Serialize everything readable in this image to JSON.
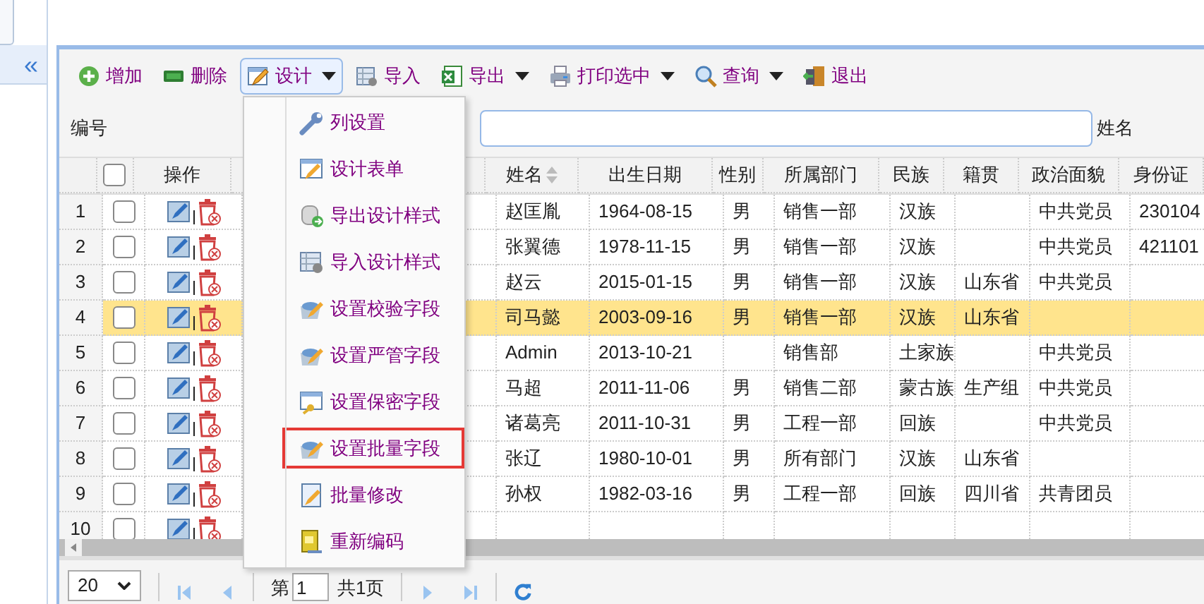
{
  "sidebar": {
    "collapse_label": "«"
  },
  "toolbar": [
    {
      "label": "增加",
      "kind": "button",
      "pressed": false
    },
    {
      "label": "删除",
      "kind": "button",
      "pressed": false
    },
    {
      "label": "设计",
      "kind": "dropdown",
      "pressed": true
    },
    {
      "label": "导入",
      "kind": "button",
      "pressed": false
    },
    {
      "label": "导出",
      "kind": "dropdown",
      "pressed": false
    },
    {
      "label": "打印选中",
      "kind": "dropdown",
      "pressed": false
    },
    {
      "label": "查询",
      "kind": "dropdown",
      "pressed": false
    },
    {
      "label": "退出",
      "kind": "button",
      "pressed": false
    }
  ],
  "search": {
    "fields": [
      {
        "label": "编号"
      },
      {
        "label": "姓名"
      }
    ]
  },
  "table": {
    "all_checked": false,
    "action_column": "操作",
    "columns": [
      "姓名",
      "出生日期",
      "性别",
      "所属部门",
      "民族",
      "籍贯",
      "政治面貌",
      "身份证"
    ],
    "rows": [
      {
        "number": "1",
        "selected": false,
        "cells": [
          "赵匡胤",
          "1964-08-15",
          "男",
          "销售一部",
          "汉族",
          "",
          "中共党员",
          "230104"
        ]
      },
      {
        "number": "2",
        "selected": false,
        "cells": [
          "张翼德",
          "1978-11-15",
          "男",
          "销售一部",
          "汉族",
          "",
          "中共党员",
          "421101"
        ]
      },
      {
        "number": "3",
        "selected": false,
        "cells": [
          "赵云",
          "2015-01-15",
          "男",
          "销售一部",
          "汉族",
          "山东省",
          "中共党员",
          ""
        ]
      },
      {
        "number": "4",
        "selected": true,
        "cells": [
          "司马懿",
          "2003-09-16",
          "男",
          "销售一部",
          "汉族",
          "山东省",
          "",
          ""
        ]
      },
      {
        "number": "5",
        "selected": false,
        "cells": [
          "Admin",
          "2013-10-21",
          "",
          "销售部",
          "土家族",
          "",
          "中共党员",
          ""
        ]
      },
      {
        "number": "6",
        "selected": false,
        "cells": [
          "马超",
          "2011-11-06",
          "男",
          "销售二部",
          "蒙古族",
          "生产组",
          "中共党员",
          ""
        ]
      },
      {
        "number": "7",
        "selected": false,
        "cells": [
          "诸葛亮",
          "2011-10-31",
          "男",
          "工程一部",
          "回族",
          "",
          "中共党员",
          ""
        ]
      },
      {
        "number": "8",
        "selected": false,
        "cells": [
          "张辽",
          "1980-10-01",
          "男",
          "所有部门",
          "汉族",
          "山东省",
          "",
          ""
        ]
      },
      {
        "number": "9",
        "selected": false,
        "cells": [
          "孙权",
          "1982-03-16",
          "男",
          "工程一部",
          "回族",
          "四川省",
          "共青团员",
          ""
        ]
      },
      {
        "number": "10",
        "selected": false,
        "cells": [
          "",
          "",
          "",
          "",
          "",
          "",
          "",
          ""
        ]
      }
    ]
  },
  "menu": [
    {
      "label": "列设置",
      "highlighted": false
    },
    {
      "label": "设计表单",
      "highlighted": false
    },
    {
      "label": "导出设计样式",
      "highlighted": false
    },
    {
      "label": "导入设计样式",
      "highlighted": false
    },
    {
      "label": "设置校验字段",
      "highlighted": false
    },
    {
      "label": "设置严管字段",
      "highlighted": false
    },
    {
      "label": "设置保密字段",
      "highlighted": false
    },
    {
      "label": "设置批量字段",
      "highlighted": true
    },
    {
      "label": "批量修改",
      "highlighted": false
    },
    {
      "label": "重新编码",
      "highlighted": false
    }
  ],
  "pager": {
    "page_size": "20",
    "page_prefix": "第",
    "page": "1",
    "page_total": "共1页"
  }
}
